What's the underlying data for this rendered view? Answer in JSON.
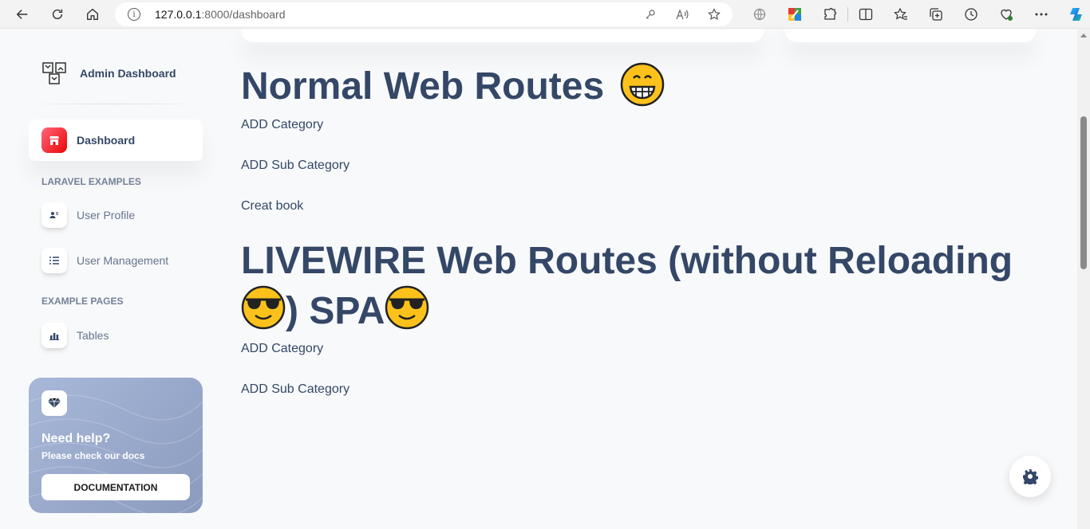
{
  "browser": {
    "url_host": "127.0.0.1",
    "url_path": ":8000/dashboard"
  },
  "sidebar": {
    "brand": "Admin Dashboard",
    "items": [
      {
        "label": "Dashboard",
        "icon": "shop-icon",
        "active": true
      },
      {
        "label": "User Profile",
        "icon": "user-icon"
      },
      {
        "label": "User Management",
        "icon": "list-icon"
      },
      {
        "label": "Tables",
        "icon": "chart-bar-icon"
      }
    ],
    "sections": {
      "laravel": "LARAVEL EXAMPLES",
      "pages": "EXAMPLE PAGES"
    },
    "help": {
      "title": "Need help?",
      "subtitle": "Please check our docs",
      "button": "DOCUMENTATION"
    }
  },
  "main": {
    "normal_title": "Normal Web Routes",
    "normal_links": [
      "ADD Category",
      "ADD Sub Category",
      "Creat book"
    ],
    "livewire_title_line1": "LIVEWIRE Web Routes (without Reloading",
    "livewire_title_line2a": ") SPA",
    "livewire_links": [
      "ADD Category",
      "ADD Sub Category"
    ]
  },
  "colors": {
    "accent": "#ea0606",
    "text": "#344767",
    "muted": "#67748e"
  }
}
